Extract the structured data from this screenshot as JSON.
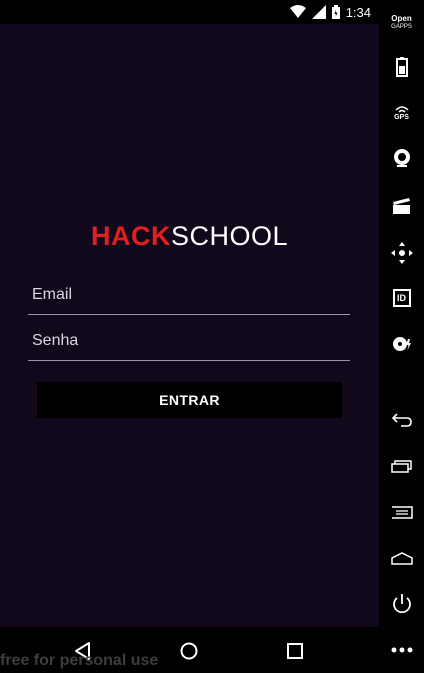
{
  "status_bar": {
    "time": "1:34"
  },
  "app": {
    "logo": {
      "part1": "HACK",
      "part2": "SCHOOL"
    },
    "email": {
      "placeholder": "Email",
      "value": ""
    },
    "password": {
      "placeholder": "Senha",
      "value": ""
    },
    "submit_label": "ENTRAR"
  },
  "toolbar": {
    "open_gapps_line1": "Open",
    "open_gapps_line2": "GAPPS",
    "gps_label": "GPS",
    "id_label": "ID"
  },
  "watermark": "free for personal use",
  "colors": {
    "background": "#12081c",
    "logo_accent": "#e01f1f",
    "button_bg": "#000000"
  }
}
